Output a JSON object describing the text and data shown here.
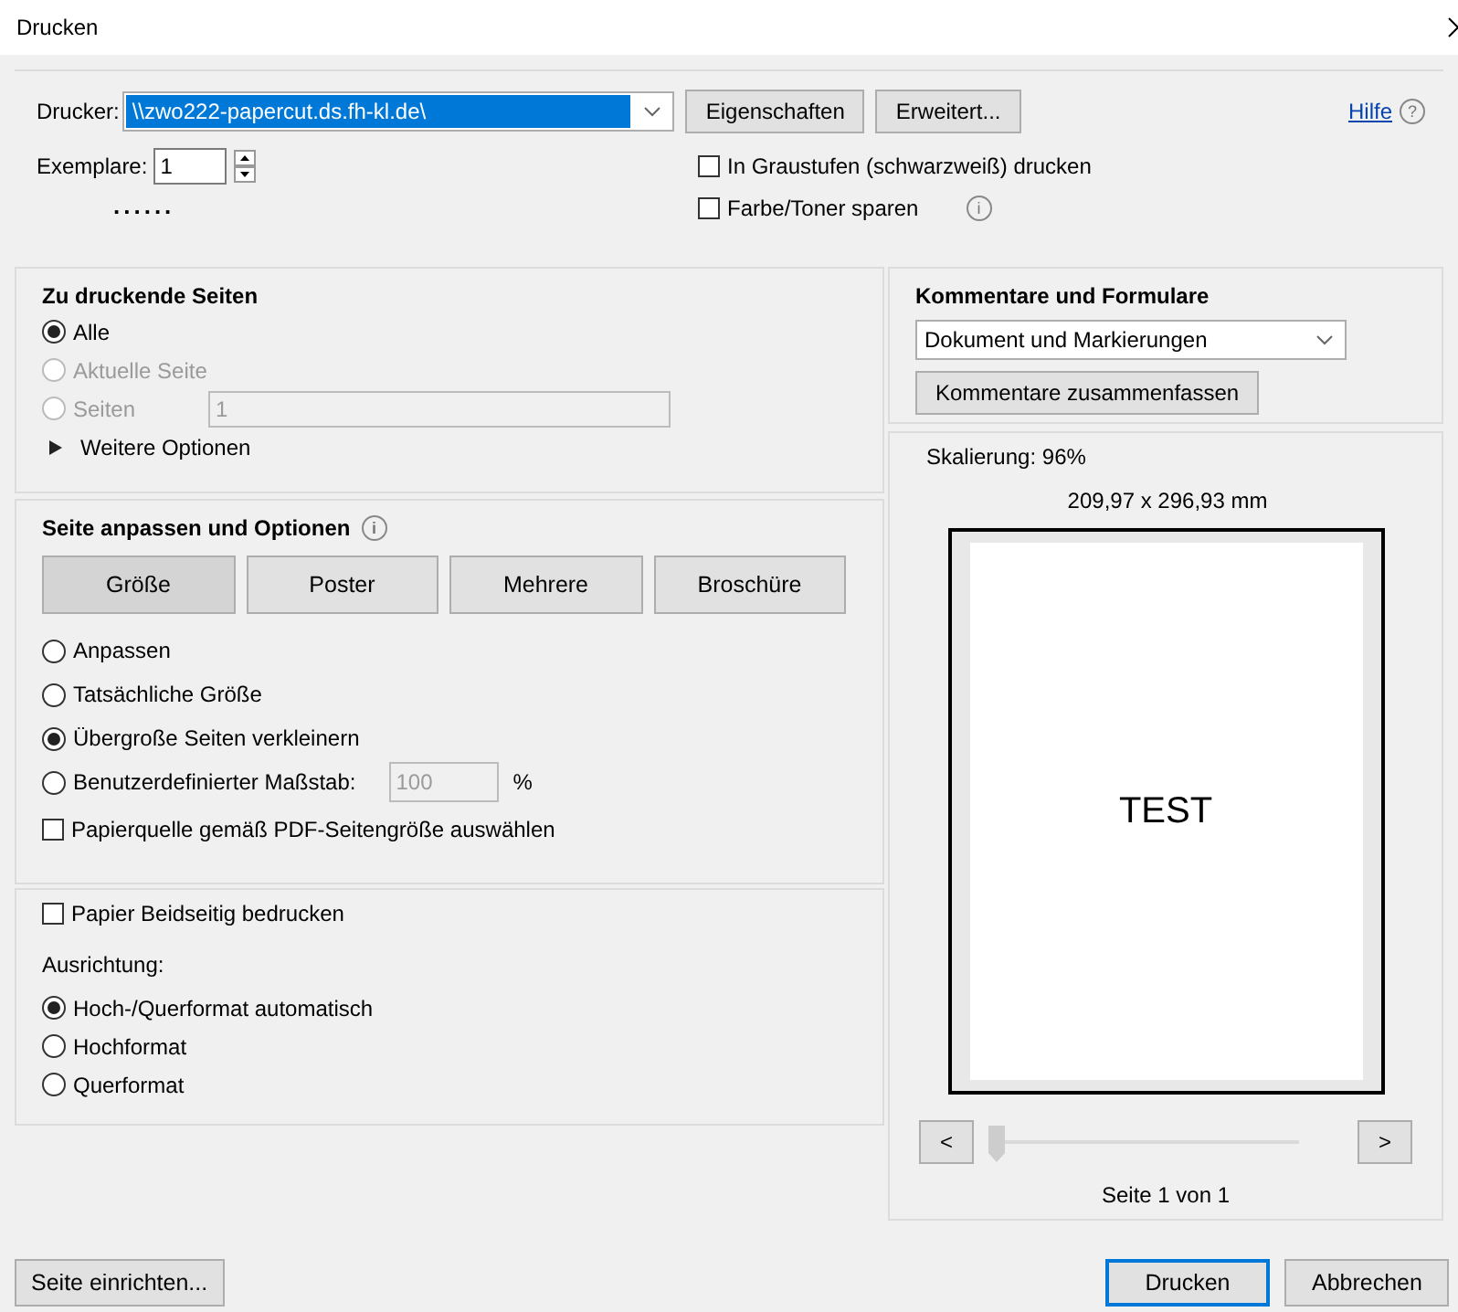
{
  "window": {
    "title": "Drucken"
  },
  "printer": {
    "label": "Drucker:",
    "value": "\\\\zwo222-papercut.ds.fh-kl.de\\",
    "buttons": [
      "Eigenschaften",
      "Erweitert..."
    ]
  },
  "help": {
    "link": "Hilfe",
    "symbol": "?"
  },
  "copies": {
    "label": "Exemplare:",
    "value": "1",
    "hint": "......"
  },
  "print_options": [
    {
      "label": "In Graustufen (schwarzweiß) drucken",
      "checked": false
    },
    {
      "label": "Farbe/Toner sparen",
      "checked": false,
      "info": "i"
    }
  ],
  "pages_section": {
    "title": "Zu druckende Seiten",
    "options": [
      {
        "label": "Alle",
        "selected": true,
        "disabled": false
      },
      {
        "label": "Aktuelle Seite",
        "selected": false,
        "disabled": true
      },
      {
        "label": "Seiten",
        "selected": false,
        "disabled": true,
        "value": "1"
      }
    ],
    "more": {
      "label": "Weitere Optionen",
      "expanded": false
    }
  },
  "fit_section": {
    "title": "Seite anpassen und Optionen",
    "info": "i",
    "tabs": [
      {
        "label": "Größe",
        "selected": true
      },
      {
        "label": "Poster",
        "selected": false
      },
      {
        "label": "Mehrere",
        "selected": false
      },
      {
        "label": "Broschüre",
        "selected": false
      }
    ],
    "options": [
      {
        "label": "Anpassen",
        "selected": false
      },
      {
        "label": "Tatsächliche Größe",
        "selected": false
      },
      {
        "label": "Übergroße Seiten verkleinern",
        "selected": true
      },
      {
        "label": "Benutzerdefinierter Maßstab:",
        "selected": false,
        "value": "100",
        "unit": "%"
      }
    ],
    "checkbox": {
      "label": "Papierquelle gemäß PDF-Seitengröße auswählen",
      "checked": false
    }
  },
  "duplex_section": {
    "checkbox": {
      "label": "Papier Beidseitig bedrucken",
      "checked": false
    },
    "orientation_label": "Ausrichtung:",
    "options": [
      {
        "label": "Hoch-/Querformat automatisch",
        "selected": true
      },
      {
        "label": "Hochformat",
        "selected": false
      },
      {
        "label": "Querformat",
        "selected": false
      }
    ]
  },
  "comments": {
    "title": "Kommentare und Formulare",
    "value": "Dokument und Markierungen",
    "button": "Kommentare zusammenfassen"
  },
  "preview": {
    "scale_label": "Skalierung:",
    "scale_value": "96%",
    "size": "209,97 x 296,93 mm",
    "page_text": "TEST",
    "prev": "<",
    "next": ">",
    "slider": {
      "level": 0
    },
    "page_info": "Seite 1 von 1"
  },
  "footer": {
    "setup": "Seite einrichten...",
    "buttons": [
      {
        "label": "Drucken",
        "default": true
      },
      {
        "label": "Abbrechen",
        "default": false
      }
    ]
  }
}
